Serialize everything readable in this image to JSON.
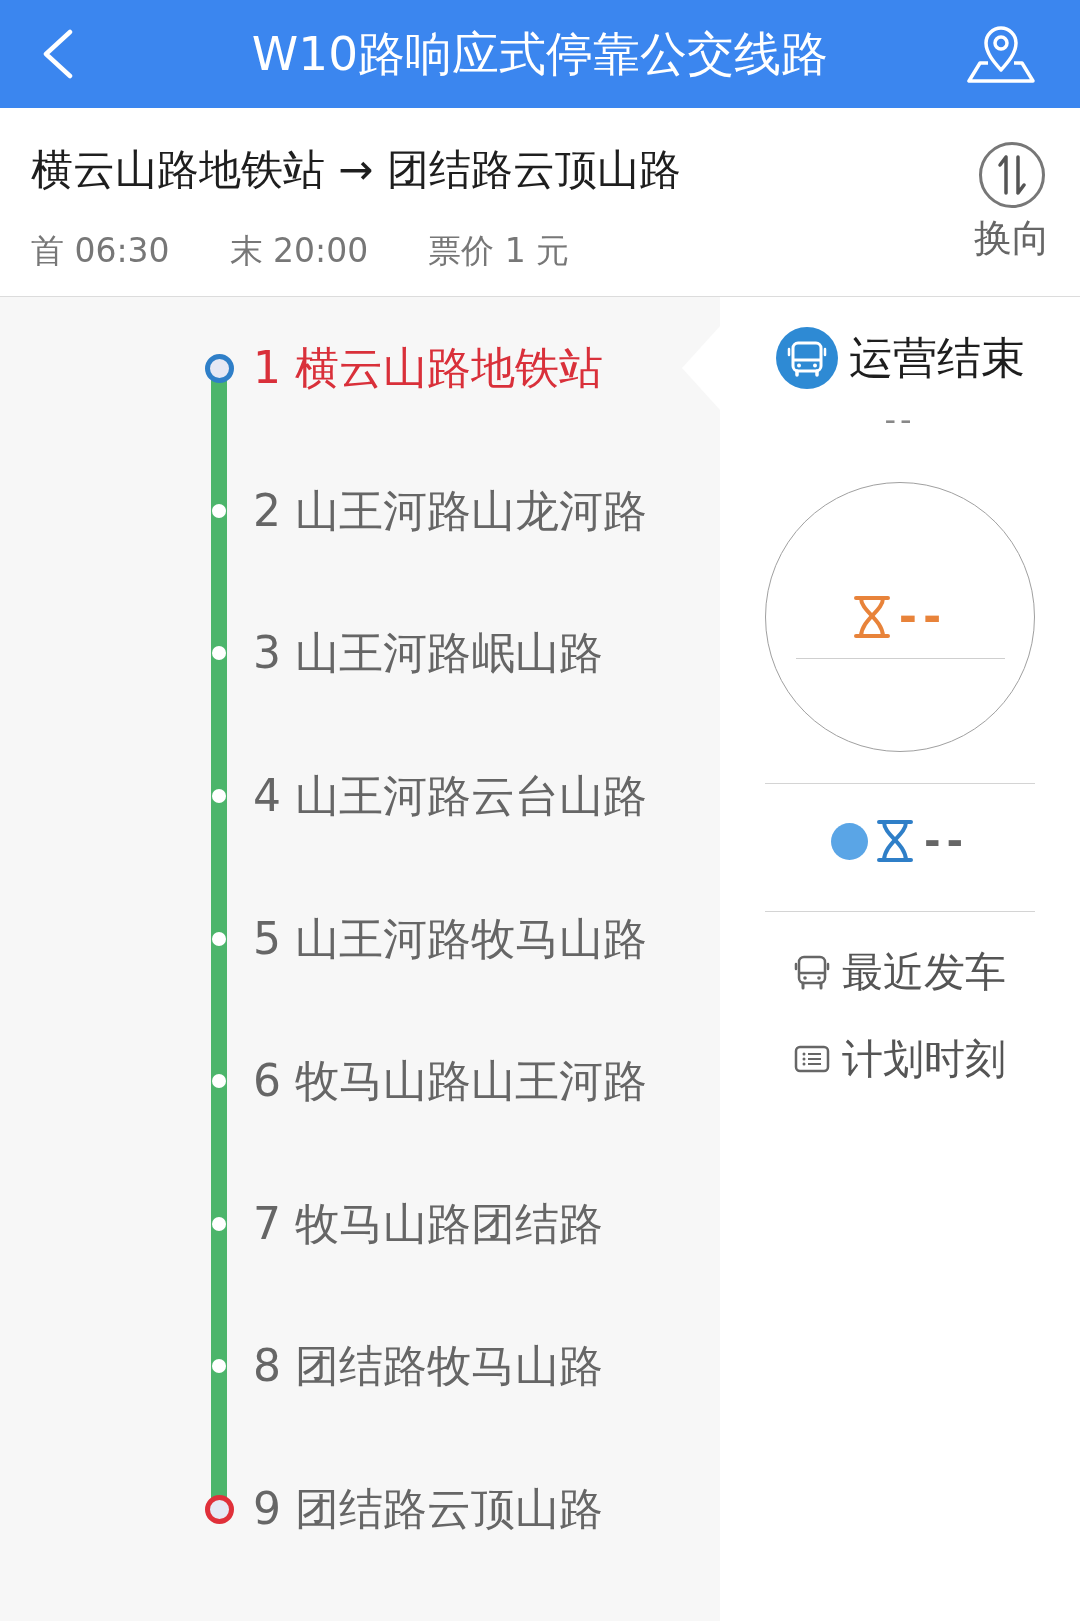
{
  "header": {
    "title": "W10路响应式停靠公交线路"
  },
  "route": {
    "direction": "横云山路地铁站 → 团结路云顶山路",
    "first_bus": "首 06:30",
    "last_bus": "末 20:00",
    "fare": "票价 1 元",
    "swap_label": "换向"
  },
  "stops": [
    {
      "label": "1 横云山路地铁站",
      "kind": "start",
      "selected": true
    },
    {
      "label": "2 山王河路山龙河路",
      "kind": "middle",
      "selected": false
    },
    {
      "label": "3 山王河路岷山路",
      "kind": "middle",
      "selected": false
    },
    {
      "label": "4 山王河路云台山路",
      "kind": "middle",
      "selected": false
    },
    {
      "label": "5 山王河路牧马山路",
      "kind": "middle",
      "selected": false
    },
    {
      "label": "6 牧马山路山王河路",
      "kind": "middle",
      "selected": false
    },
    {
      "label": "7 牧马山路团结路",
      "kind": "middle",
      "selected": false
    },
    {
      "label": "8 团结路牧马山路",
      "kind": "middle",
      "selected": false
    },
    {
      "label": "9 团结路云顶山路",
      "kind": "end",
      "selected": false
    }
  ],
  "bus_panel": {
    "status": "运营结束",
    "next_time": "--",
    "gauge_reading": "--",
    "live_reading": "--",
    "links": [
      {
        "kind": "bus",
        "label": "最近发车"
      },
      {
        "kind": "schedule",
        "label": "计划时刻"
      }
    ]
  }
}
